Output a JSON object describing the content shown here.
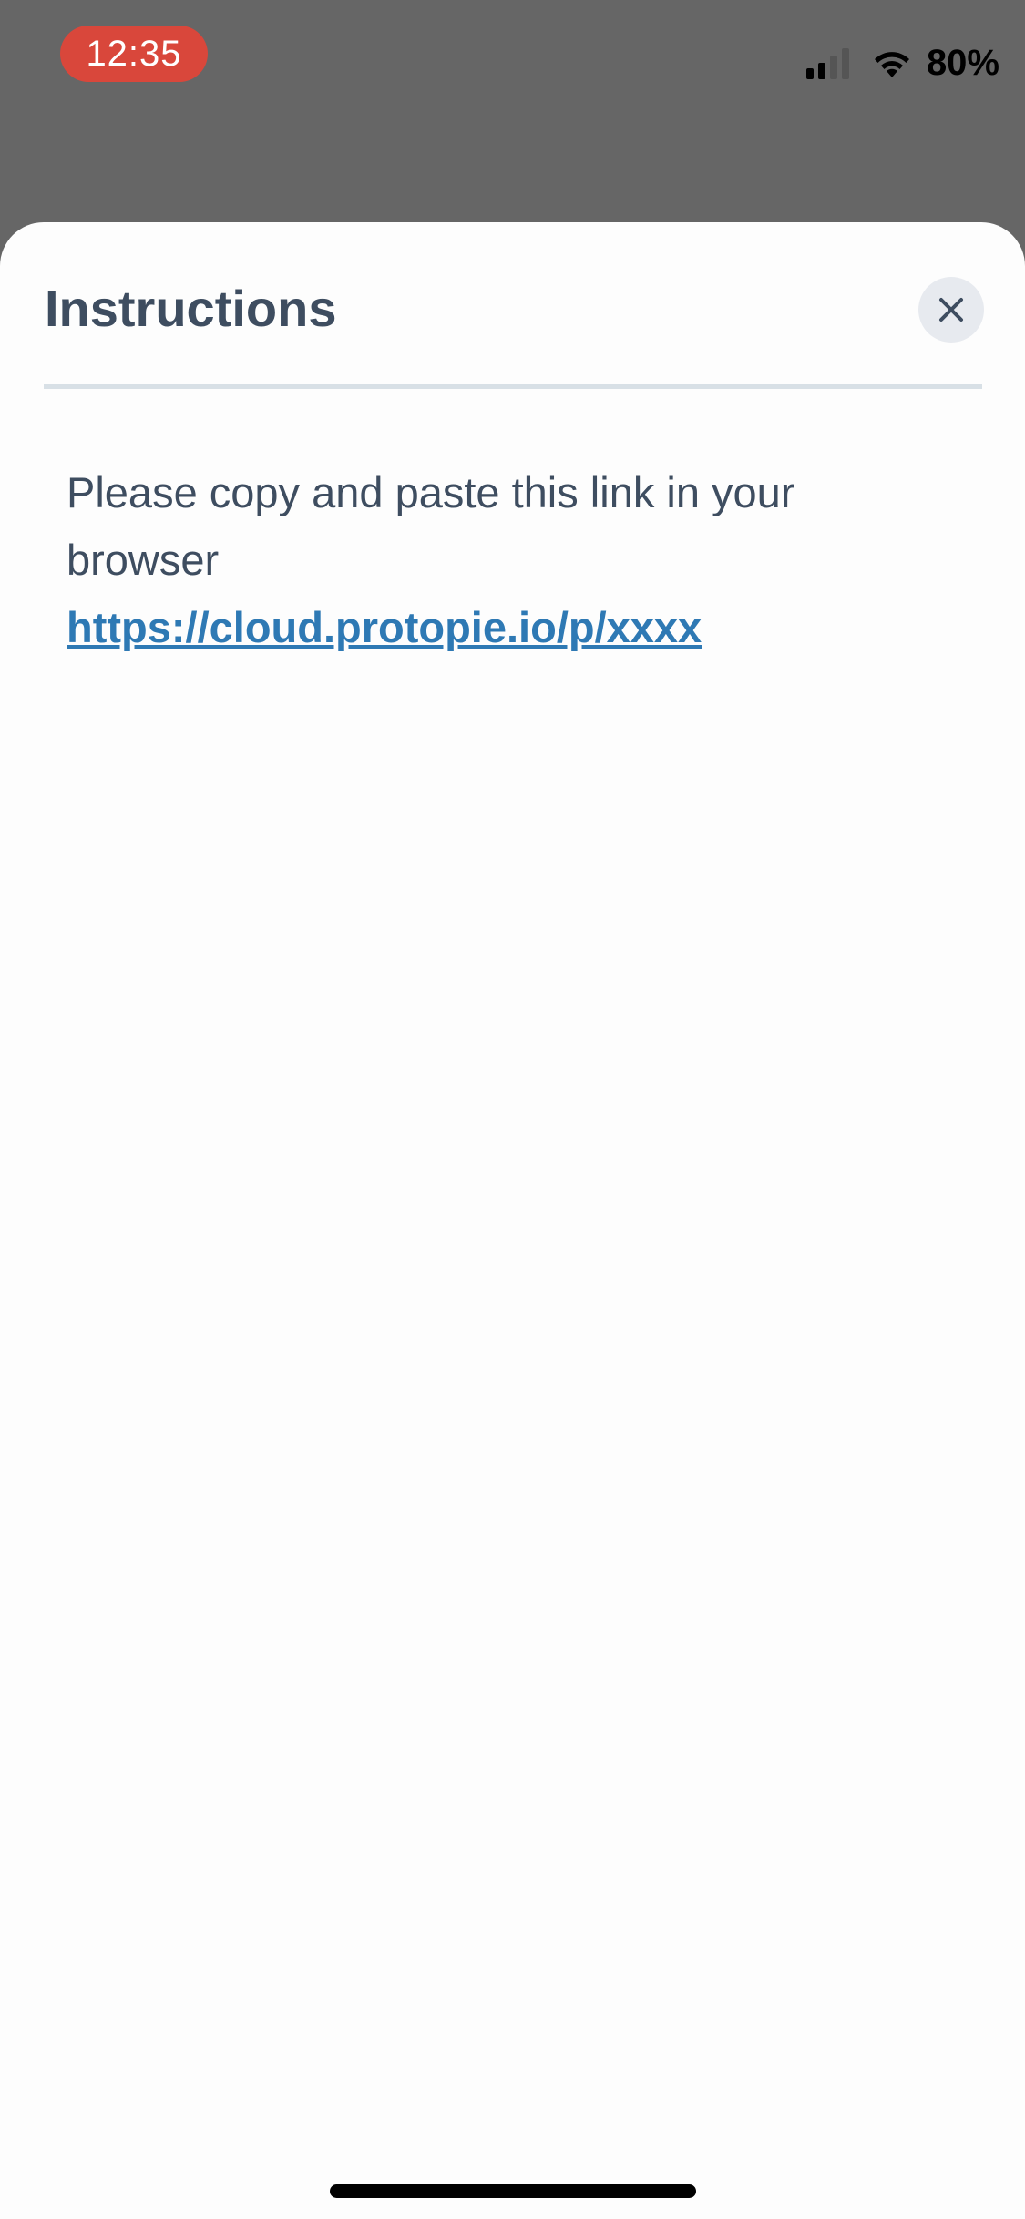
{
  "status_bar": {
    "time": "12:35",
    "battery": "80%",
    "icons": [
      "signal-icon",
      "wifi-icon"
    ]
  },
  "sheet": {
    "title": "Instructions",
    "close_icon": "close-icon",
    "message": "Please copy and paste this link in your browser",
    "link": "https://cloud.protopie.io/p/xxxx"
  },
  "colors": {
    "time_pill": "#d9473b",
    "title": "#3e4d60",
    "link": "#2e79b4",
    "backdrop": "#666666"
  }
}
